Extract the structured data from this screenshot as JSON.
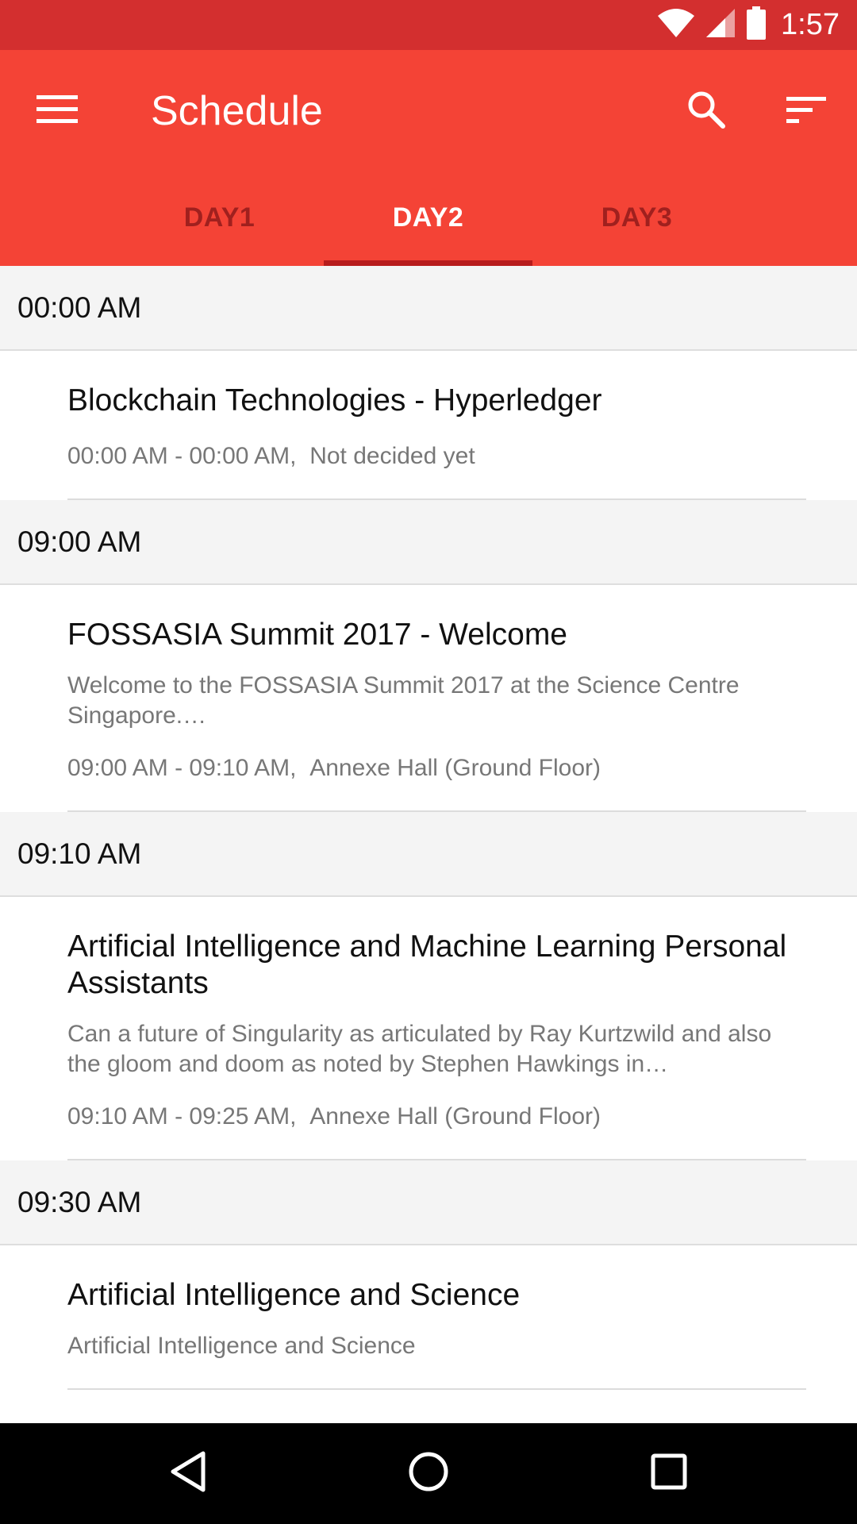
{
  "status_bar": {
    "time": "1:57",
    "icons": [
      "wifi-icon",
      "cell-signal-icon",
      "battery-icon"
    ]
  },
  "app_bar": {
    "title": "Schedule",
    "icons": [
      "menu-icon",
      "search-icon",
      "filter-sort-icon"
    ],
    "color": "#f44336"
  },
  "tabs": [
    {
      "label": "DAY1",
      "selected": false
    },
    {
      "label": "DAY2",
      "selected": true
    },
    {
      "label": "DAY3",
      "selected": false
    }
  ],
  "schedule": {
    "groups": [
      {
        "time": "00:00 AM",
        "sessions": [
          {
            "title": "Blockchain Technologies - Hyperledger",
            "description": "",
            "time_range": "00:00 AM - 00:00 AM,",
            "location": "Not decided yet"
          }
        ]
      },
      {
        "time": "09:00 AM",
        "sessions": [
          {
            "title": "FOSSASIA Summit 2017 - Welcome",
            "description": "Welcome to the FOSSASIA Summit 2017 at the Science Centre Singapore.…",
            "time_range": "09:00 AM - 09:10 AM,",
            "location": "Annexe Hall (Ground Floor)"
          }
        ]
      },
      {
        "time": "09:10 AM",
        "sessions": [
          {
            "title": "Artificial Intelligence and Machine Learning Personal Assistants",
            "description": "Can a future of Singularity as articulated by Ray Kurtzwild and also the gloom and doom as noted by Stephen Hawkings in…",
            "time_range": "09:10 AM - 09:25 AM,",
            "location": "Annexe Hall (Ground Floor)"
          }
        ]
      },
      {
        "time": "09:30 AM",
        "sessions": [
          {
            "title": "Artificial Intelligence and Science",
            "description": "Artificial Intelligence and Science",
            "time_range": "",
            "location": ""
          }
        ]
      }
    ]
  },
  "nav_bar": {
    "icons": [
      "back-icon",
      "home-icon",
      "recents-icon"
    ]
  }
}
